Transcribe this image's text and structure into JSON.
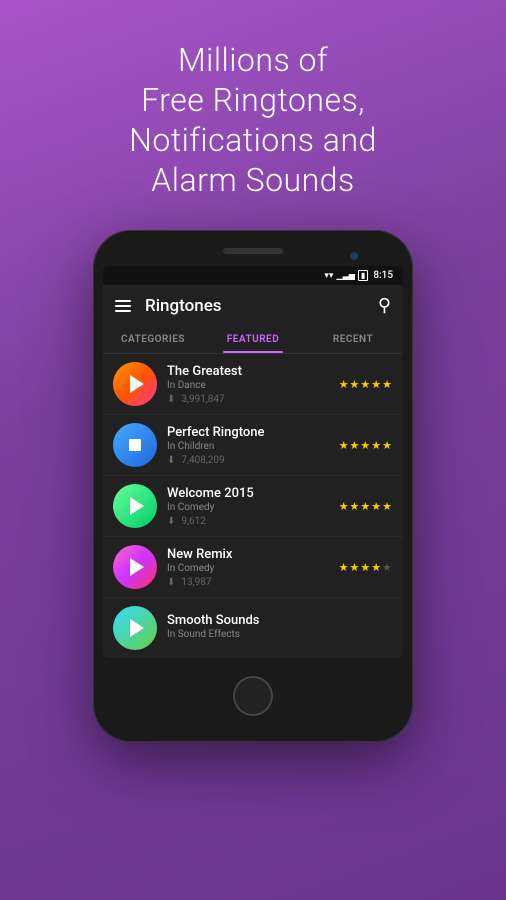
{
  "hero": {
    "line1": "Millions of",
    "line2": "Free Ringtones,",
    "line3": "Notifications and",
    "line4": "Alarm Sounds"
  },
  "statusBar": {
    "time": "8:15"
  },
  "appBar": {
    "title": "Ringtones",
    "searchLabel": "Search"
  },
  "tabs": [
    {
      "id": "categories",
      "label": "CATEGORIES",
      "active": false
    },
    {
      "id": "featured",
      "label": "FEATURED",
      "active": true
    },
    {
      "id": "recent",
      "label": "RECENT",
      "active": false
    }
  ],
  "songs": [
    {
      "name": "The Greatest",
      "category": "In Dance",
      "downloads": "3,991,847",
      "stars": 5,
      "iconGradient": "icon-gradient-1",
      "playing": true
    },
    {
      "name": "Perfect Ringtone",
      "category": "In Children",
      "downloads": "7,408,209",
      "stars": 5,
      "iconGradient": "icon-gradient-2",
      "playing": false,
      "stopped": true
    },
    {
      "name": "Welcome 2015",
      "category": "In Comedy",
      "downloads": "9,612",
      "stars": 5,
      "iconGradient": "icon-gradient-3",
      "playing": true
    },
    {
      "name": "New Remix",
      "category": "In Comedy",
      "downloads": "13,987",
      "stars": 4,
      "iconGradient": "icon-gradient-4",
      "playing": true
    },
    {
      "name": "Smooth Sounds",
      "category": "In Sound Effects",
      "downloads": "",
      "stars": 0,
      "iconGradient": "icon-gradient-5",
      "playing": true,
      "partial": true
    }
  ]
}
